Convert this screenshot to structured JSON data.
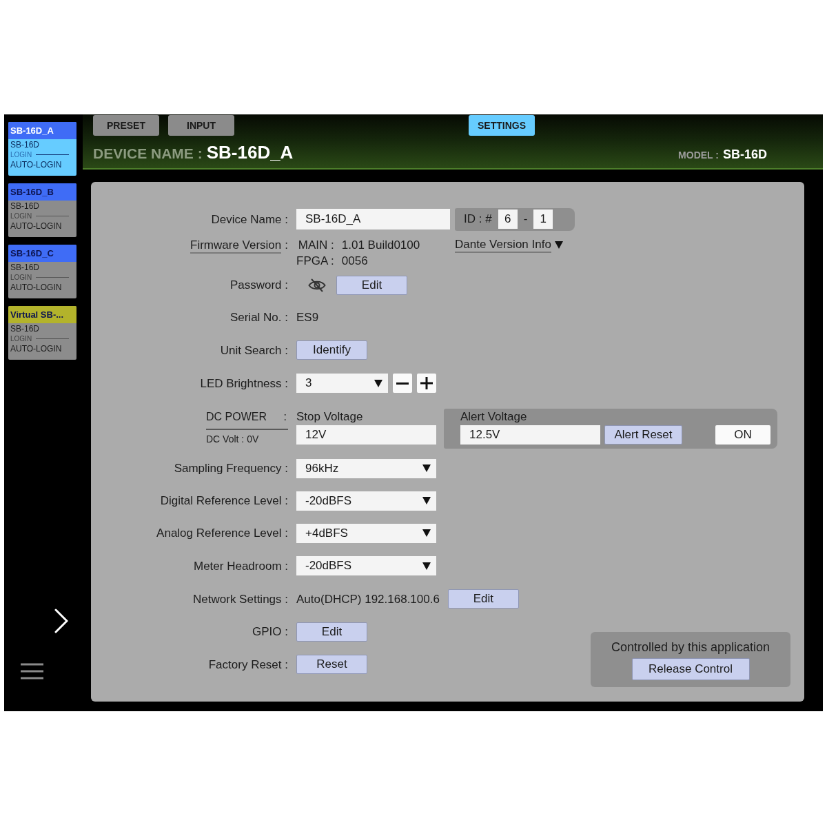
{
  "sidebar": {
    "devices": [
      {
        "name": "SB-16D_A",
        "model": "SB-16D",
        "login": "LOGIN",
        "auto_login": "AUTO-LOGIN",
        "color": "#3f6cf6",
        "selected": true
      },
      {
        "name": "SB-16D_B",
        "model": "SB-16D",
        "login": "LOGIN",
        "auto_login": "AUTO-LOGIN",
        "color": "#3f6cf6",
        "selected": false
      },
      {
        "name": "SB-16D_C",
        "model": "SB-16D",
        "login": "LOGIN",
        "auto_login": "AUTO-LOGIN",
        "color": "#3f6cf6",
        "selected": false
      },
      {
        "name": "Virtual SB-...",
        "model": "SB-16D",
        "login": "LOGIN",
        "auto_login": "AUTO-LOGIN",
        "color": "#b3b32b",
        "selected": false
      }
    ]
  },
  "header": {
    "tabs": [
      {
        "label": "PRESET",
        "selected": false
      },
      {
        "label": "INPUT",
        "selected": false
      },
      {
        "label": "SETTINGS",
        "selected": true
      }
    ],
    "device_name_label": "DEVICE NAME :",
    "device_name": "SB-16D_A",
    "model_label": "MODEL :",
    "model": "SB-16D"
  },
  "settings": {
    "device_name": {
      "label": "Device Name :",
      "value": "SB-16D_A",
      "id_label": "ID : #",
      "id_unit": "6",
      "id_separator": "-",
      "id_channel": "1"
    },
    "firmware": {
      "label": "Firmware Version",
      "colon": ":",
      "versions": [
        {
          "name": "MAIN :",
          "value": "1.01 Build0100"
        },
        {
          "name": "FPGA :",
          "value": "0056"
        }
      ],
      "dante_link": "Dante Version Info"
    },
    "password": {
      "label": "Password :",
      "button": "Edit"
    },
    "serial": {
      "label": "Serial No. :",
      "value": "ES9"
    },
    "unit_search": {
      "label": "Unit Search :",
      "button": "Identify"
    },
    "led_brightness": {
      "label": "LED Brightness :",
      "value": "3"
    },
    "dc_power": {
      "label": "DC POWER",
      "colon": ":",
      "reading": "DC Volt : 0V",
      "stop_label": "Stop Voltage",
      "stop_value": "12V",
      "alert_label": "Alert Voltage",
      "alert_value": "12.5V",
      "alert_reset": "Alert Reset",
      "alert_switch": "ON"
    },
    "selects": [
      {
        "label": "Sampling Frequency :",
        "value": "96kHz"
      },
      {
        "label": "Digital Reference Level :",
        "value": "-20dBFS"
      },
      {
        "label": "Analog Reference Level :",
        "value": "+4dBFS"
      },
      {
        "label": "Meter Headroom :",
        "value": "-20dBFS"
      }
    ],
    "network": {
      "label": "Network Settings :",
      "value": "Auto(DHCP) 192.168.100.6",
      "button": "Edit"
    },
    "gpio": {
      "label": "GPIO :",
      "button": "Edit"
    },
    "factory_reset": {
      "label": "Factory Reset :",
      "button": "Reset"
    },
    "control": {
      "status": "Controlled by this application",
      "button": "Release Control"
    }
  }
}
